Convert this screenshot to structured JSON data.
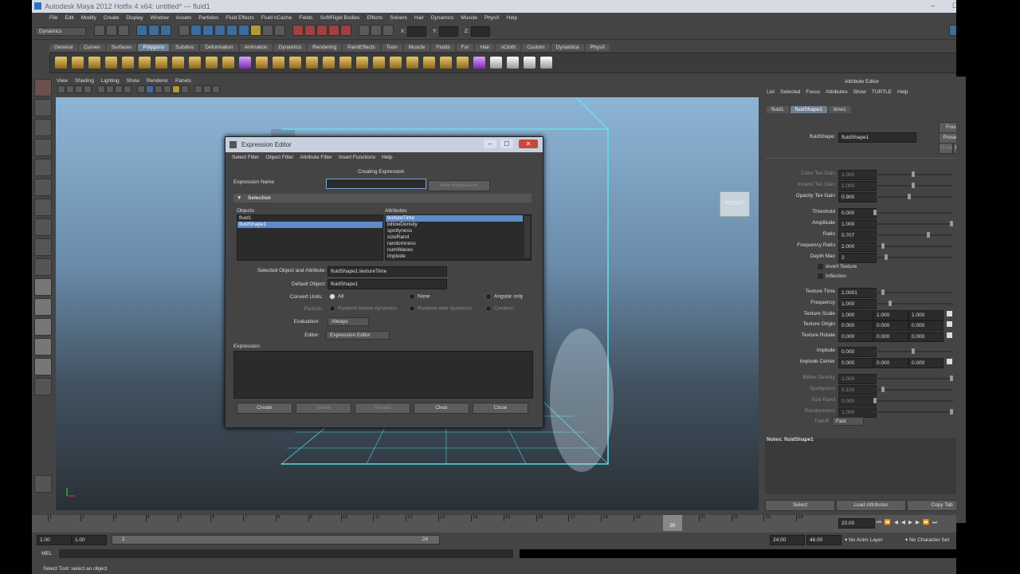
{
  "window": {
    "title": "Autodesk Maya 2012 Hotfix 4 x64: untitled*   ---   fluid1",
    "controls": [
      "–",
      "☐",
      "✕"
    ]
  },
  "menubar": [
    "File",
    "Edit",
    "Modify",
    "Create",
    "Display",
    "Window",
    "Assets",
    "Particles",
    "Fluid Effects",
    "Fluid nCache",
    "Fields",
    "Soft/Rigid Bodies",
    "Effects",
    "Solvers",
    "Hair",
    "Dynamics",
    "Muscle",
    "PhysX",
    "Help"
  ],
  "statusline": {
    "menuset": "Dynamics",
    "x_label": "X:",
    "y_label": "Y:",
    "z_label": "Z:"
  },
  "shelf_tabs": [
    {
      "label": "General",
      "active": false
    },
    {
      "label": "Curves",
      "active": false
    },
    {
      "label": "Surfaces",
      "active": false
    },
    {
      "label": "Polygons",
      "active": true
    },
    {
      "label": "Subdivs",
      "active": false
    },
    {
      "label": "Deformation",
      "active": false
    },
    {
      "label": "Animation",
      "active": false
    },
    {
      "label": "Dynamics",
      "active": false
    },
    {
      "label": "Rendering",
      "active": false
    },
    {
      "label": "PaintEffects",
      "active": false
    },
    {
      "label": "Toon",
      "active": false
    },
    {
      "label": "Muscle",
      "active": false
    },
    {
      "label": "Fluids",
      "active": false
    },
    {
      "label": "Fur",
      "active": false
    },
    {
      "label": "Hair",
      "active": false
    },
    {
      "label": "nCloth",
      "active": false
    },
    {
      "label": "Custom",
      "active": false
    },
    {
      "label": "Dynamica",
      "active": false
    },
    {
      "label": "PhysX",
      "active": false
    }
  ],
  "viewport_menu": [
    "View",
    "Shading",
    "Lighting",
    "Show",
    "Renderer",
    "Panels"
  ],
  "viewcube_label": "FRONT",
  "expression_editor": {
    "title": "Expression Editor",
    "menu": [
      "Select Filter",
      "Object Filter",
      "Attribute Filter",
      "Insert Functions",
      "Help"
    ],
    "status": "Creating Expression",
    "expression_name_label": "Expression Name",
    "expression_name_value": "",
    "new_expression_label": "New Expression",
    "selection_header": "Selection",
    "objects_label": "Objects",
    "objects": [
      {
        "name": "fluid1",
        "selected": false
      },
      {
        "name": "fluidShape1",
        "selected": true
      }
    ],
    "attributes_label": "Attributes",
    "attributes": [
      {
        "name": "textureTime",
        "selected": true
      },
      {
        "name": "billowDensity",
        "selected": false
      },
      {
        "name": "spottyness",
        "selected": false
      },
      {
        "name": "sizeRand",
        "selected": false
      },
      {
        "name": "randomness",
        "selected": false
      },
      {
        "name": "numWaves",
        "selected": false
      },
      {
        "name": "implode",
        "selected": false
      }
    ],
    "selected_obj_attr_label": "Selected Object and Attribute:",
    "selected_obj_attr_value": "fluidShape1.textureTime",
    "default_object_label": "Default Object:",
    "default_object_value": "fluidShape1",
    "convert_units_label": "Convert Units:",
    "convert_units_options": [
      {
        "label": "All",
        "on": true
      },
      {
        "label": "None",
        "on": false
      },
      {
        "label": "Angular only",
        "on": false
      }
    ],
    "particle_label": "Particle:",
    "particle_options": [
      "Runtime before dynamics",
      "Runtime after dynamics",
      "Creation"
    ],
    "evaluation_label": "Evaluation:",
    "evaluation_value": "Always",
    "editor_label": "Editor:",
    "editor_value": "Expression Editor",
    "expression_label": "Expression:",
    "expression_text": "",
    "buttons": [
      {
        "label": "Create",
        "enabled": true
      },
      {
        "label": "Delete",
        "enabled": false
      },
      {
        "label": "Reload",
        "enabled": false
      },
      {
        "label": "Clear",
        "enabled": true
      },
      {
        "label": "Close",
        "enabled": true
      }
    ]
  },
  "attribute_editor": {
    "header": "Attribute Editor",
    "menu": [
      "List",
      "Selected",
      "Focus",
      "Attributes",
      "Show",
      "TURTLE",
      "Help"
    ],
    "tabs": [
      {
        "label": "fluid1",
        "active": false
      },
      {
        "label": "fluidShape1",
        "active": true
      },
      {
        "label": "time1",
        "active": false
      }
    ],
    "node_label": "fluidShape:",
    "node_value": "fluidShape1",
    "focus_label": "Focus",
    "presets_label": "Presets*",
    "show_label": "Show",
    "hide_label": "Hide",
    "rows": [
      {
        "name": "Color Tex Gain",
        "value": "1.000",
        "slider": 0.5,
        "dim": true
      },
      {
        "name": "Incand Tex Gain",
        "value": "1.000",
        "slider": 0.5,
        "dim": true
      },
      {
        "name": "Opacity Tex Gain",
        "value": "0.900",
        "slider": 0.45,
        "dim": false
      },
      {
        "name": "Threshold",
        "value": "0.000",
        "slider": 0.0,
        "dim": false
      },
      {
        "name": "Amplitude",
        "value": "1.000",
        "slider": 1.0,
        "dim": false
      },
      {
        "name": "Ratio",
        "value": "0.707",
        "slider": 0.7,
        "dim": false
      },
      {
        "name": "Frequency Ratio",
        "value": "2.000",
        "slider": 0.1,
        "dim": false
      },
      {
        "name": "Depth Max",
        "value": "2",
        "slider": 0.15,
        "dim": false
      },
      {
        "name": "Texture Time",
        "value": "1.0001",
        "slider": 0.1,
        "dim": false
      },
      {
        "name": "Frequency",
        "value": "1.000",
        "slider": 0.2,
        "dim": false
      },
      {
        "name": "Implode",
        "value": "0.000",
        "slider": 0.5,
        "dim": false
      },
      {
        "name": "Billow Density",
        "value": "1.000",
        "slider": 1.0,
        "dim": true
      },
      {
        "name": "Spottyness",
        "value": "0.100",
        "slider": 0.1,
        "dim": true
      },
      {
        "name": "Size Rand",
        "value": "0.000",
        "slider": 0.0,
        "dim": true
      },
      {
        "name": "Randomness",
        "value": "1.000",
        "slider": 1.0,
        "dim": true
      }
    ],
    "checkboxes": [
      "Invert Texture",
      "Inflection"
    ],
    "vec_rows": [
      {
        "name": "Texture Scale",
        "values": [
          "1.000",
          "1.000",
          "1.000"
        ]
      },
      {
        "name": "Texture Origin",
        "values": [
          "0.000",
          "0.000",
          "0.000"
        ]
      },
      {
        "name": "Texture Rotate",
        "values": [
          "0.000",
          "0.000",
          "0.000"
        ]
      },
      {
        "name": "Implode Center",
        "values": [
          "0.000",
          "0.000",
          "0.000"
        ]
      }
    ],
    "falloff_label": "Falloff",
    "falloff_value": "Fast",
    "notes_label": "Notes: fluidShape1",
    "bottom_buttons": [
      "Select",
      "Load Attributes",
      "Copy Tab"
    ]
  },
  "timeline": {
    "ticks": [
      "1",
      "2",
      "3",
      "4",
      "5",
      "6",
      "7",
      "8",
      "9",
      "10",
      "11",
      "12",
      "13",
      "14",
      "15",
      "16",
      "17",
      "18",
      "19",
      "20",
      "21",
      "22",
      "23",
      "24"
    ],
    "current_frame": "20",
    "current_time_field": "20.00"
  },
  "range": {
    "start": "1.00",
    "start2": "1.00",
    "slider_start": "1",
    "slider_end": "24",
    "end": "24.00",
    "end2": "48.00",
    "anim_layer": "No Anim Layer",
    "char_set": "No Character Set"
  },
  "cmdline": {
    "label": "MEL"
  },
  "helpline": {
    "text": "Select Tool: select an object"
  }
}
